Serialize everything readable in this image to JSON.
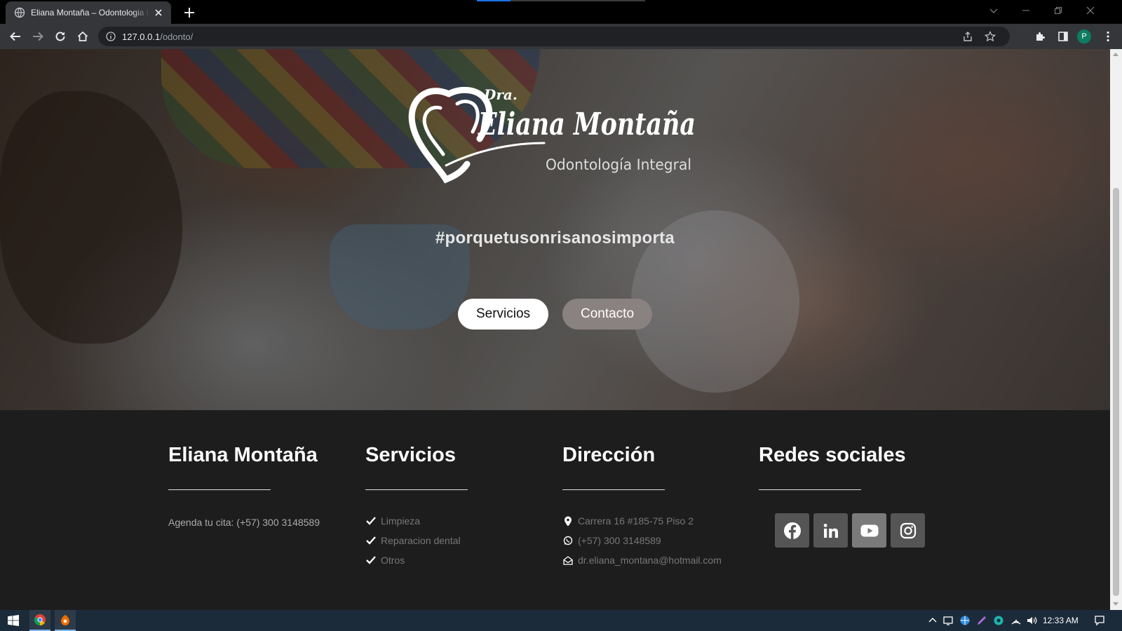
{
  "browser": {
    "tab_title": "Eliana Montaña – Odontologia Integral",
    "url_host": "127.0.0.1",
    "url_path": "/odonto/",
    "profile_initial": "P",
    "colors": {
      "tab_active": "#35363a",
      "toolbar": "#35363a",
      "omnibox": "#202124",
      "accent": "#1a73e8"
    },
    "icons": [
      "globe-icon",
      "close-icon",
      "plus-icon",
      "back-arrow-icon",
      "forward-arrow-icon",
      "reload-icon",
      "home-icon",
      "info-icon",
      "share-icon",
      "star-icon",
      "puzzle-icon",
      "side-panel-icon",
      "kebab-menu-icon"
    ]
  },
  "hero": {
    "logo": {
      "prefix": "Dra.",
      "name": "Eliana Montaña",
      "tagline": "Odontología Integral"
    },
    "hashtag": "#porquetusonrisanosimporta",
    "buttons": {
      "servicios": "Servicios",
      "contacto": "Contacto"
    }
  },
  "footer": {
    "about": {
      "heading": "Eliana Montaña",
      "agenda": "Agenda tu cita: (+57) 300 3148589"
    },
    "servicios": {
      "heading": "Servicios",
      "items": [
        "Limpieza",
        "Reparacion dental",
        "Otros"
      ]
    },
    "direccion": {
      "heading": "Dirección",
      "address": "Carrera 16 #185-75 Piso 2",
      "phone": "(+57) 300 3148589",
      "email": "dr.eliana_montana@hotmail.com"
    },
    "redes": {
      "heading": "Redes sociales",
      "networks": [
        "facebook-icon",
        "linkedin-icon",
        "youtube-icon",
        "instagram-icon"
      ]
    }
  },
  "taskbar": {
    "clock": "12:33 AM",
    "icons": [
      "windows-start-icon",
      "chrome-icon",
      "app-icon",
      "chevron-up-icon",
      "network-icon",
      "volume-icon",
      "notification-icon"
    ]
  }
}
